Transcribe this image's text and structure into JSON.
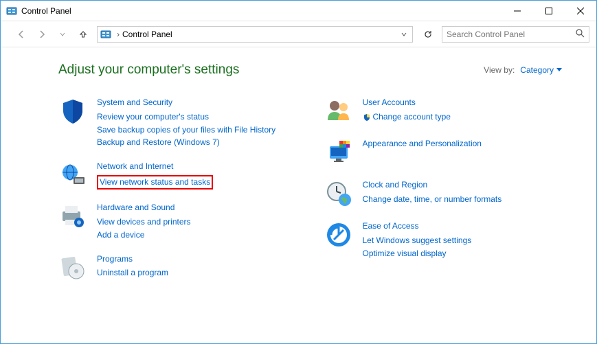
{
  "window": {
    "title": "Control Panel"
  },
  "address": {
    "crumb": "Control Panel"
  },
  "search": {
    "placeholder": "Search Control Panel"
  },
  "header": {
    "page_title": "Adjust your computer's settings",
    "viewby_label": "View by:",
    "viewby_value": "Category"
  },
  "left": [
    {
      "title": "System and Security",
      "links": [
        "Review your computer's status",
        "Save backup copies of your files with File History",
        "Backup and Restore (Windows 7)"
      ]
    },
    {
      "title": "Network and Internet",
      "links": [
        "View network status and tasks"
      ]
    },
    {
      "title": "Hardware and Sound",
      "links": [
        "View devices and printers",
        "Add a device"
      ]
    },
    {
      "title": "Programs",
      "links": [
        "Uninstall a program"
      ]
    }
  ],
  "right": [
    {
      "title": "User Accounts",
      "links": [
        "Change account type"
      ]
    },
    {
      "title": "Appearance and Personalization",
      "links": []
    },
    {
      "title": "Clock and Region",
      "links": [
        "Change date, time, or number formats"
      ]
    },
    {
      "title": "Ease of Access",
      "links": [
        "Let Windows suggest settings",
        "Optimize visual display"
      ]
    }
  ]
}
